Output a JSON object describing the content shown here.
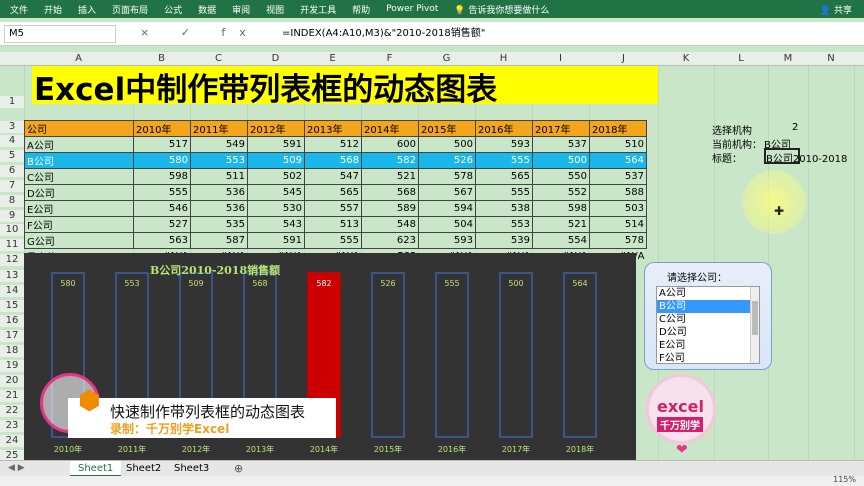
{
  "ribbon": {
    "tabs": [
      "文件",
      "开始",
      "插入",
      "页面布局",
      "公式",
      "数据",
      "审阅",
      "视图",
      "开发工具",
      "帮助",
      "Power Pivot"
    ],
    "tell_me": "告诉我你想要做什么",
    "share": "共享"
  },
  "formula_bar": {
    "name_box": "M5",
    "buttons": "× ✓ fx",
    "formula": "=INDEX(A4:A10,M3)&\"2010-2018销售额\""
  },
  "columns": [
    "A",
    "B",
    "C",
    "D",
    "E",
    "F",
    "G",
    "H",
    "I",
    "J",
    "K",
    "L",
    "M",
    "N"
  ],
  "rows": [
    "1",
    "3",
    "4",
    "5",
    "6",
    "7",
    "8",
    "9",
    "10",
    "11",
    "12",
    "13",
    "14",
    "15",
    "16",
    "17",
    "18",
    "19",
    "20",
    "21",
    "22",
    "23",
    "24",
    "25"
  ],
  "sheet_title": "Excel中制作带列表框的动态图表",
  "table": {
    "header": [
      "公司",
      "2010年",
      "2011年",
      "2012年",
      "2013年",
      "2014年",
      "2015年",
      "2016年",
      "2017年",
      "2018年"
    ],
    "rows": [
      [
        "A公司",
        "517",
        "549",
        "591",
        "512",
        "600",
        "500",
        "593",
        "537",
        "510"
      ],
      [
        "B公司",
        "580",
        "553",
        "509",
        "568",
        "582",
        "526",
        "555",
        "500",
        "564"
      ],
      [
        "C公司",
        "598",
        "511",
        "502",
        "547",
        "521",
        "578",
        "565",
        "550",
        "537"
      ],
      [
        "D公司",
        "555",
        "536",
        "545",
        "565",
        "568",
        "567",
        "555",
        "552",
        "588"
      ],
      [
        "E公司",
        "546",
        "536",
        "530",
        "557",
        "589",
        "594",
        "538",
        "598",
        "503"
      ],
      [
        "F公司",
        "527",
        "535",
        "543",
        "513",
        "548",
        "504",
        "553",
        "521",
        "514"
      ],
      [
        "G公司",
        "563",
        "587",
        "591",
        "555",
        "623",
        "593",
        "539",
        "554",
        "578"
      ]
    ],
    "max_row": [
      "最大值",
      "#N/A",
      "#N/A",
      "#N/A",
      "#N/A",
      "582",
      "#N/A",
      "#N/A",
      "#N/A",
      "#N/A"
    ]
  },
  "info_panel": {
    "select_label": "选择机构",
    "select_value": "2",
    "current_label": "当前机构：",
    "current_value": "B公司",
    "title_label": "标题：",
    "title_value": "B公司2010-2018"
  },
  "chart_data": {
    "type": "bar",
    "title": "B公司2010-2018销售额",
    "categories": [
      "2010年",
      "2011年",
      "2012年",
      "2013年",
      "2014年",
      "2015年",
      "2016年",
      "2017年",
      "2018年"
    ],
    "values": [
      580,
      553,
      509,
      568,
      582,
      526,
      555,
      500,
      564
    ],
    "highlight_index": 4,
    "colors": {
      "bar_outline": "#3f5fa8",
      "highlight": "#cc0000",
      "label": "#b9e47a",
      "background": "#333333"
    },
    "xlabel": "",
    "ylabel": ""
  },
  "listbox": {
    "label": "请选择公司：",
    "options": [
      "A公司",
      "B公司",
      "C公司",
      "D公司",
      "E公司",
      "F公司"
    ],
    "selected_index": 1
  },
  "overlay": {
    "line1": "快速制作带列表框的动态图表",
    "line2": "录制：千万别学Excel"
  },
  "brand": {
    "line1": "excel",
    "line2": "千万别学"
  },
  "sheets": [
    "Sheet1",
    "Sheet2",
    "Sheet3"
  ],
  "active_sheet": 0,
  "zoom": "115%"
}
